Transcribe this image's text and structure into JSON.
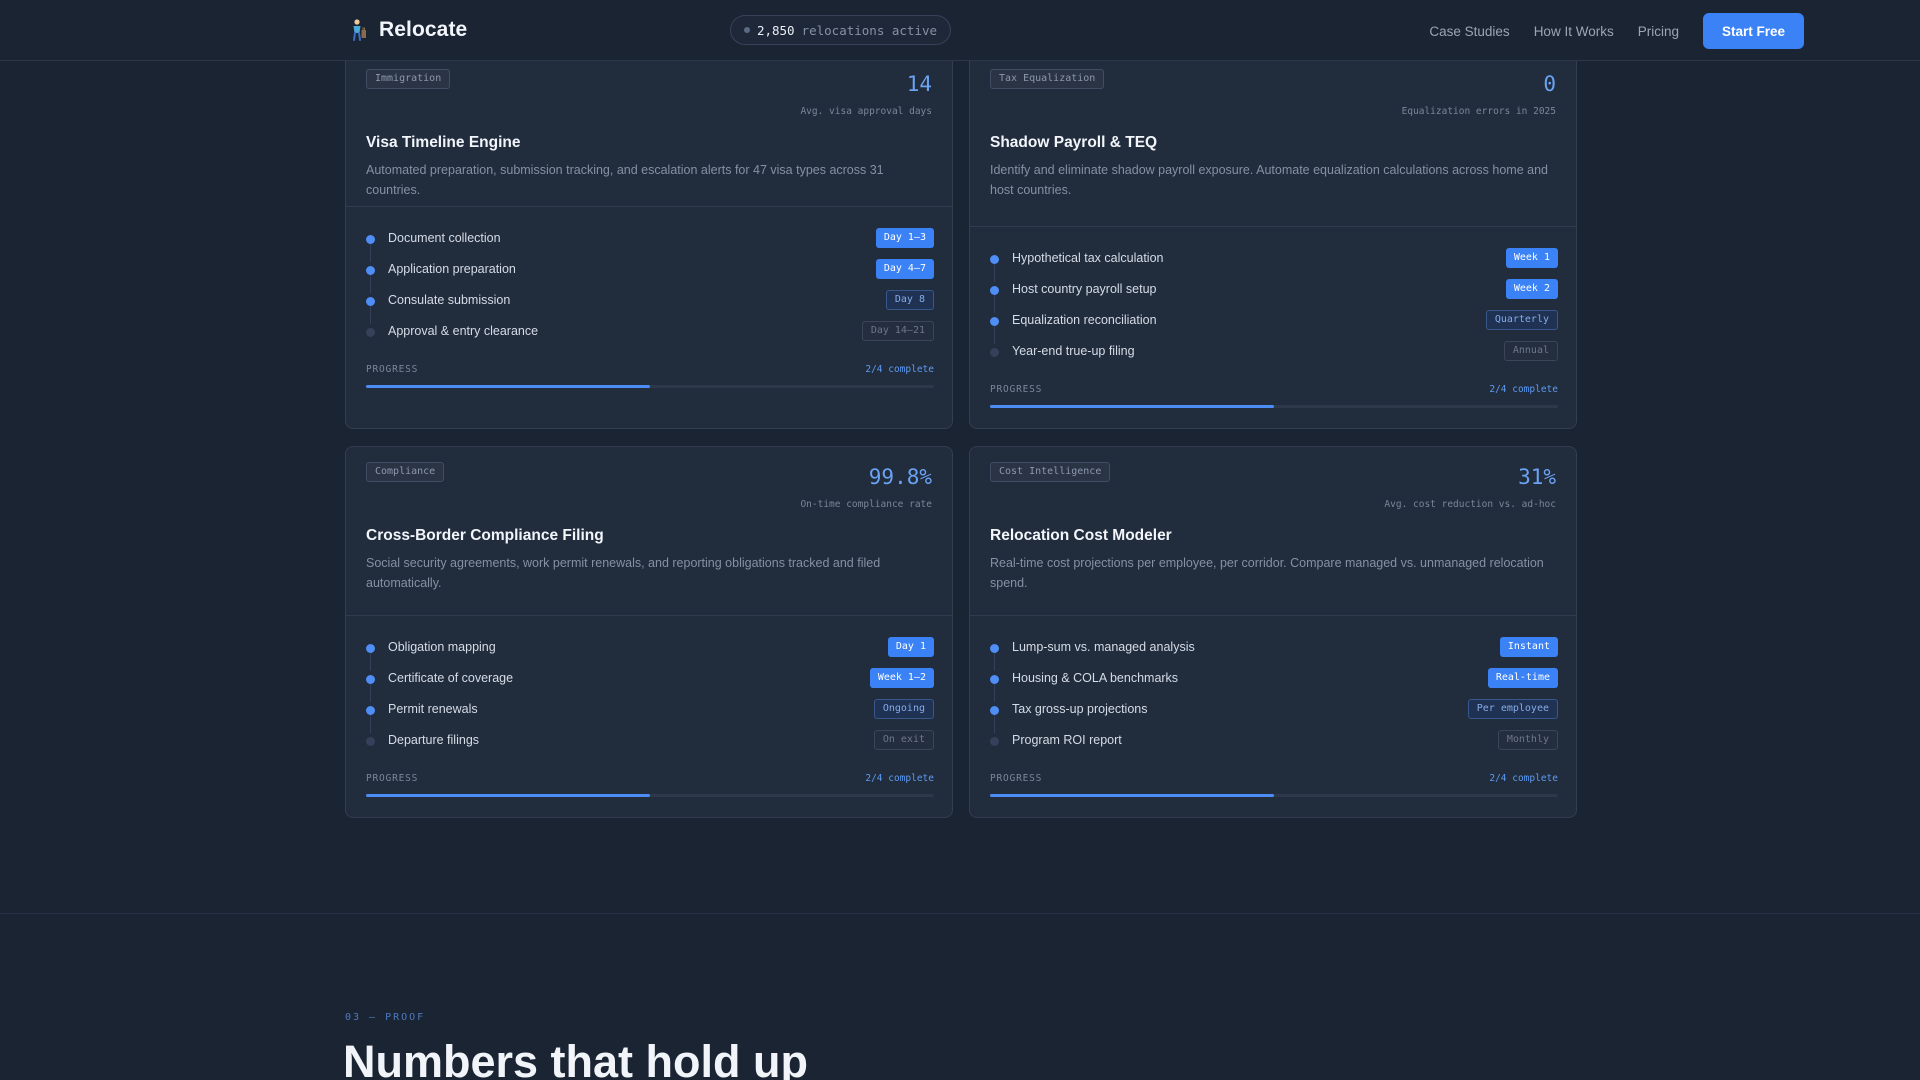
{
  "nav": {
    "brand": "Relocate",
    "live_count": "2,850",
    "live_label": "relocations active",
    "links": [
      "Case Studies",
      "How It Works",
      "Pricing"
    ],
    "cta": "Start Free"
  },
  "cards": [
    {
      "tag": "Immigration",
      "metric_value": "14",
      "metric_label": "Avg. visa approval days",
      "title": "Visa Timeline Engine",
      "description": "Automated preparation, submission tracking, and escalation alerts for 47 visa types across 31 countries.",
      "steps": [
        {
          "label": "Document collection",
          "badge": "Day 1–3",
          "state": "filled"
        },
        {
          "label": "Application preparation",
          "badge": "Day 4–7",
          "state": "filled"
        },
        {
          "label": "Consulate submission",
          "badge": "Day 8",
          "state": "outline"
        },
        {
          "label": "Approval & entry clearance",
          "badge": "Day 14–21",
          "state": "muted"
        }
      ],
      "progress_label": "PROGRESS",
      "progress_status": "2/4 complete",
      "progress_fraction": 0.5
    },
    {
      "tag": "Tax Equalization",
      "metric_value": "0",
      "metric_label": "Equalization errors in 2025",
      "title": "Shadow Payroll & TEQ",
      "description": "Identify and eliminate shadow payroll exposure. Automate equalization calculations across home and host countries.",
      "steps": [
        {
          "label": "Hypothetical tax calculation",
          "badge": "Week 1",
          "state": "filled"
        },
        {
          "label": "Host country payroll setup",
          "badge": "Week 2",
          "state": "filled"
        },
        {
          "label": "Equalization reconciliation",
          "badge": "Quarterly",
          "state": "outline"
        },
        {
          "label": "Year-end true-up filing",
          "badge": "Annual",
          "state": "muted"
        }
      ],
      "progress_label": "PROGRESS",
      "progress_status": "2/4 complete",
      "progress_fraction": 0.5
    },
    {
      "tag": "Compliance",
      "metric_value": "99.8%",
      "metric_label": "On-time compliance rate",
      "title": "Cross-Border Compliance Filing",
      "description": "Social security agreements, work permit renewals, and reporting obligations tracked and filed automatically.",
      "steps": [
        {
          "label": "Obligation mapping",
          "badge": "Day 1",
          "state": "filled"
        },
        {
          "label": "Certificate of coverage",
          "badge": "Week 1–2",
          "state": "filled"
        },
        {
          "label": "Permit renewals",
          "badge": "Ongoing",
          "state": "outline"
        },
        {
          "label": "Departure filings",
          "badge": "On exit",
          "state": "muted"
        }
      ],
      "progress_label": "PROGRESS",
      "progress_status": "2/4 complete",
      "progress_fraction": 0.5
    },
    {
      "tag": "Cost Intelligence",
      "metric_value": "31%",
      "metric_label": "Avg. cost reduction vs. ad-hoc",
      "title": "Relocation Cost Modeler",
      "description": "Real-time cost projections per employee, per corridor. Compare managed vs. unmanaged relocation spend.",
      "steps": [
        {
          "label": "Lump-sum vs. managed analysis",
          "badge": "Instant",
          "state": "filled"
        },
        {
          "label": "Housing & COLA benchmarks",
          "badge": "Real-time",
          "state": "filled"
        },
        {
          "label": "Tax gross-up projections",
          "badge": "Per employee",
          "state": "outline"
        },
        {
          "label": "Program ROI report",
          "badge": "Monthly",
          "state": "muted"
        }
      ],
      "progress_label": "PROGRESS",
      "progress_status": "2/4 complete",
      "progress_fraction": 0.5
    }
  ],
  "proof": {
    "eyebrow": "03 — PROOF",
    "headline": "Numbers that hold up"
  },
  "colors": {
    "accent": "#3b82f6",
    "background": "#1b2433",
    "card": "#212c3d"
  },
  "icons": {
    "brand": "person-with-luggage-icon"
  }
}
